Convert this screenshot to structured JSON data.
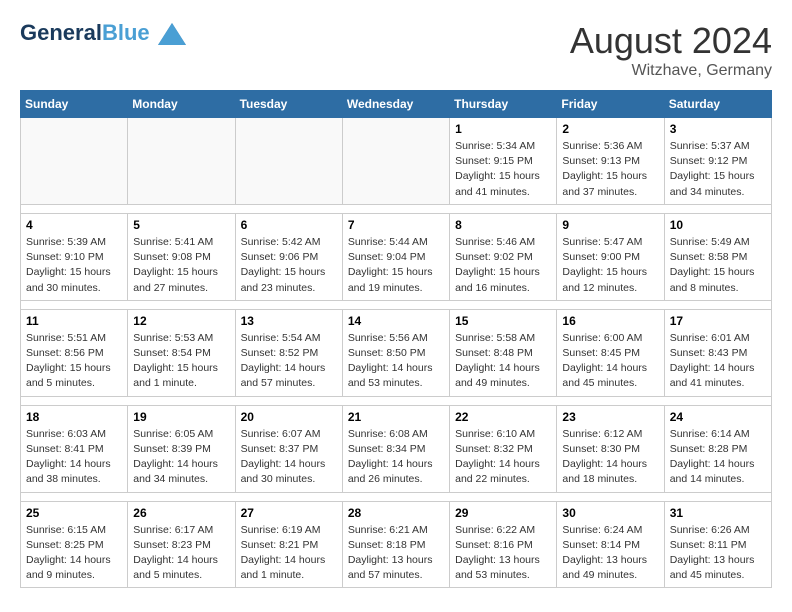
{
  "logo": {
    "line1": "General",
    "line2": "Blue"
  },
  "title": {
    "month_year": "August 2024",
    "location": "Witzhave, Germany"
  },
  "days_of_week": [
    "Sunday",
    "Monday",
    "Tuesday",
    "Wednesday",
    "Thursday",
    "Friday",
    "Saturday"
  ],
  "weeks": [
    [
      {
        "day": "",
        "info": ""
      },
      {
        "day": "",
        "info": ""
      },
      {
        "day": "",
        "info": ""
      },
      {
        "day": "",
        "info": ""
      },
      {
        "day": "1",
        "info": "Sunrise: 5:34 AM\nSunset: 9:15 PM\nDaylight: 15 hours\nand 41 minutes."
      },
      {
        "day": "2",
        "info": "Sunrise: 5:36 AM\nSunset: 9:13 PM\nDaylight: 15 hours\nand 37 minutes."
      },
      {
        "day": "3",
        "info": "Sunrise: 5:37 AM\nSunset: 9:12 PM\nDaylight: 15 hours\nand 34 minutes."
      }
    ],
    [
      {
        "day": "4",
        "info": "Sunrise: 5:39 AM\nSunset: 9:10 PM\nDaylight: 15 hours\nand 30 minutes."
      },
      {
        "day": "5",
        "info": "Sunrise: 5:41 AM\nSunset: 9:08 PM\nDaylight: 15 hours\nand 27 minutes."
      },
      {
        "day": "6",
        "info": "Sunrise: 5:42 AM\nSunset: 9:06 PM\nDaylight: 15 hours\nand 23 minutes."
      },
      {
        "day": "7",
        "info": "Sunrise: 5:44 AM\nSunset: 9:04 PM\nDaylight: 15 hours\nand 19 minutes."
      },
      {
        "day": "8",
        "info": "Sunrise: 5:46 AM\nSunset: 9:02 PM\nDaylight: 15 hours\nand 16 minutes."
      },
      {
        "day": "9",
        "info": "Sunrise: 5:47 AM\nSunset: 9:00 PM\nDaylight: 15 hours\nand 12 minutes."
      },
      {
        "day": "10",
        "info": "Sunrise: 5:49 AM\nSunset: 8:58 PM\nDaylight: 15 hours\nand 8 minutes."
      }
    ],
    [
      {
        "day": "11",
        "info": "Sunrise: 5:51 AM\nSunset: 8:56 PM\nDaylight: 15 hours\nand 5 minutes."
      },
      {
        "day": "12",
        "info": "Sunrise: 5:53 AM\nSunset: 8:54 PM\nDaylight: 15 hours\nand 1 minute."
      },
      {
        "day": "13",
        "info": "Sunrise: 5:54 AM\nSunset: 8:52 PM\nDaylight: 14 hours\nand 57 minutes."
      },
      {
        "day": "14",
        "info": "Sunrise: 5:56 AM\nSunset: 8:50 PM\nDaylight: 14 hours\nand 53 minutes."
      },
      {
        "day": "15",
        "info": "Sunrise: 5:58 AM\nSunset: 8:48 PM\nDaylight: 14 hours\nand 49 minutes."
      },
      {
        "day": "16",
        "info": "Sunrise: 6:00 AM\nSunset: 8:45 PM\nDaylight: 14 hours\nand 45 minutes."
      },
      {
        "day": "17",
        "info": "Sunrise: 6:01 AM\nSunset: 8:43 PM\nDaylight: 14 hours\nand 41 minutes."
      }
    ],
    [
      {
        "day": "18",
        "info": "Sunrise: 6:03 AM\nSunset: 8:41 PM\nDaylight: 14 hours\nand 38 minutes."
      },
      {
        "day": "19",
        "info": "Sunrise: 6:05 AM\nSunset: 8:39 PM\nDaylight: 14 hours\nand 34 minutes."
      },
      {
        "day": "20",
        "info": "Sunrise: 6:07 AM\nSunset: 8:37 PM\nDaylight: 14 hours\nand 30 minutes."
      },
      {
        "day": "21",
        "info": "Sunrise: 6:08 AM\nSunset: 8:34 PM\nDaylight: 14 hours\nand 26 minutes."
      },
      {
        "day": "22",
        "info": "Sunrise: 6:10 AM\nSunset: 8:32 PM\nDaylight: 14 hours\nand 22 minutes."
      },
      {
        "day": "23",
        "info": "Sunrise: 6:12 AM\nSunset: 8:30 PM\nDaylight: 14 hours\nand 18 minutes."
      },
      {
        "day": "24",
        "info": "Sunrise: 6:14 AM\nSunset: 8:28 PM\nDaylight: 14 hours\nand 14 minutes."
      }
    ],
    [
      {
        "day": "25",
        "info": "Sunrise: 6:15 AM\nSunset: 8:25 PM\nDaylight: 14 hours\nand 9 minutes."
      },
      {
        "day": "26",
        "info": "Sunrise: 6:17 AM\nSunset: 8:23 PM\nDaylight: 14 hours\nand 5 minutes."
      },
      {
        "day": "27",
        "info": "Sunrise: 6:19 AM\nSunset: 8:21 PM\nDaylight: 14 hours\nand 1 minute."
      },
      {
        "day": "28",
        "info": "Sunrise: 6:21 AM\nSunset: 8:18 PM\nDaylight: 13 hours\nand 57 minutes."
      },
      {
        "day": "29",
        "info": "Sunrise: 6:22 AM\nSunset: 8:16 PM\nDaylight: 13 hours\nand 53 minutes."
      },
      {
        "day": "30",
        "info": "Sunrise: 6:24 AM\nSunset: 8:14 PM\nDaylight: 13 hours\nand 49 minutes."
      },
      {
        "day": "31",
        "info": "Sunrise: 6:26 AM\nSunset: 8:11 PM\nDaylight: 13 hours\nand 45 minutes."
      }
    ]
  ]
}
